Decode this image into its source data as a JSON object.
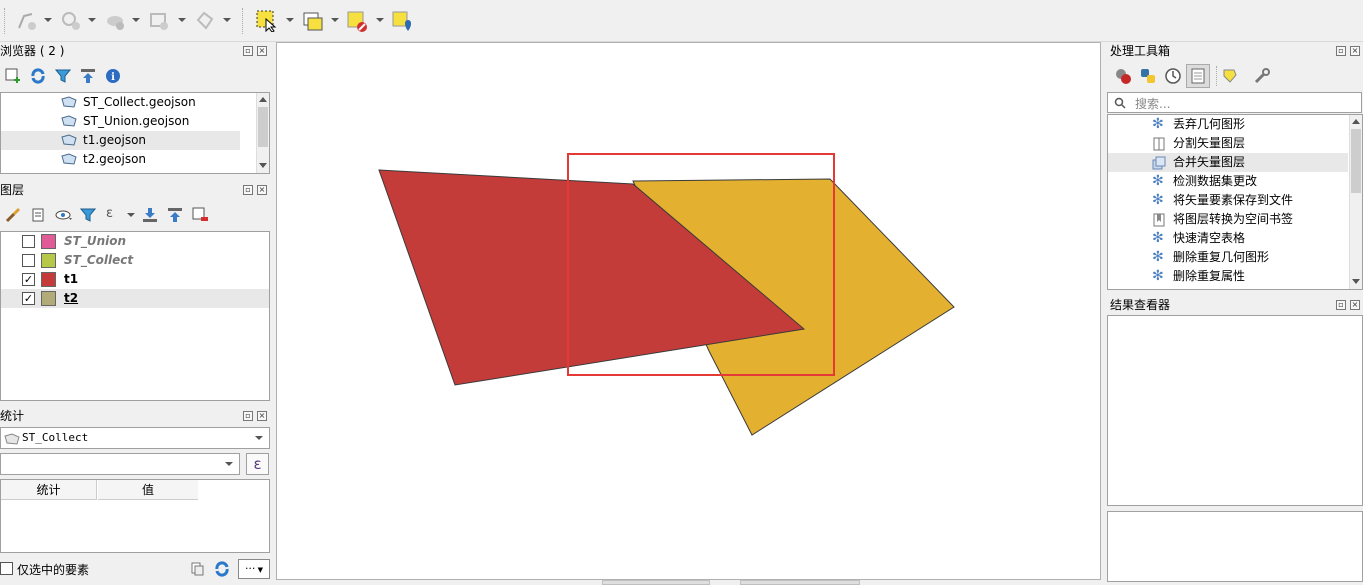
{
  "browser": {
    "title": "浏览器 ( 2 )",
    "items": [
      {
        "label": "ST_Collect.geojson"
      },
      {
        "label": "ST_Union.geojson"
      },
      {
        "label": "t1.geojson"
      },
      {
        "label": "t2.geojson"
      }
    ]
  },
  "layers": {
    "title": "图层",
    "items": [
      {
        "label": "ST_Union",
        "checked": false,
        "color": "#e05c96"
      },
      {
        "label": "ST_Collect",
        "checked": false,
        "color": "#b5c84a"
      },
      {
        "label": "t1",
        "checked": true,
        "color": "#c43c3a"
      },
      {
        "label": "t2",
        "checked": true,
        "color": "#b0ab78"
      }
    ]
  },
  "stats": {
    "title": "统计",
    "layer_select": "ST_Collect",
    "expr_icon": "ε",
    "columns": [
      "统计",
      "值"
    ],
    "selected_only_label": "仅选中的要素",
    "more_label": "···"
  },
  "toolbox": {
    "title": "处理工具箱",
    "search_placeholder": "搜索...",
    "items": [
      {
        "label": "丢弃几何图形",
        "icon": "gear-icon"
      },
      {
        "label": "分割矢量图层",
        "icon": "split-layer-icon"
      },
      {
        "label": "合并矢量图层",
        "icon": "merge-layer-icon"
      },
      {
        "label": "检测数据集更改",
        "icon": "gear-icon"
      },
      {
        "label": "将矢量要素保存到文件",
        "icon": "gear-icon"
      },
      {
        "label": "将图层转换为空间书签",
        "icon": "bookmark-icon"
      },
      {
        "label": "快速清空表格",
        "icon": "gear-icon"
      },
      {
        "label": "删除重复几何图形",
        "icon": "gear-icon"
      },
      {
        "label": "删除重复属性",
        "icon": "gear-icon"
      }
    ]
  },
  "results": {
    "title": "结果查看器"
  },
  "colors": {
    "t1_fill": "#c43c3a",
    "t2_fill": "#e3b030",
    "selection_rect": "#e53935"
  }
}
